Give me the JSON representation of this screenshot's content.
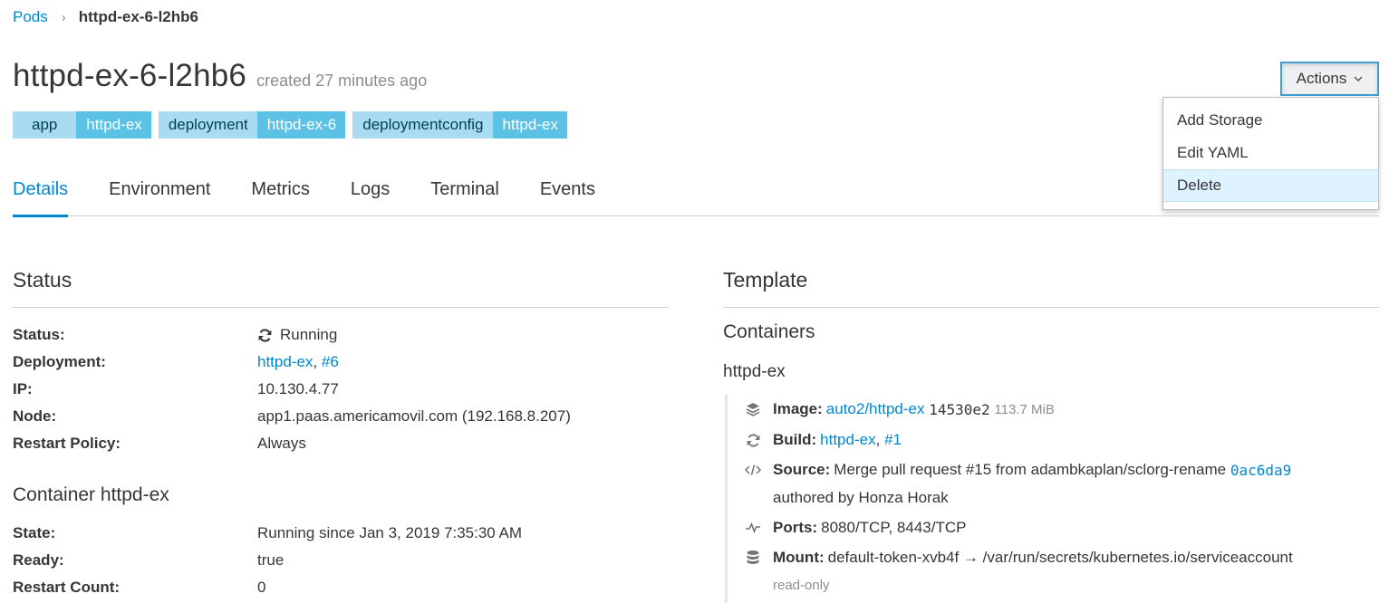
{
  "breadcrumb": {
    "parent": "Pods",
    "separator": "›",
    "current": "httpd-ex-6-l2hb6"
  },
  "header": {
    "title": "httpd-ex-6-l2hb6",
    "created": "created 27 minutes ago"
  },
  "labels": [
    {
      "key": "app",
      "value": "httpd-ex"
    },
    {
      "key": "deployment",
      "value": "httpd-ex-6"
    },
    {
      "key": "deploymentconfig",
      "value": "httpd-ex"
    }
  ],
  "actions": {
    "button_label": "Actions",
    "menu": [
      {
        "label": "Add Storage"
      },
      {
        "label": "Edit YAML"
      },
      {
        "label": "Delete"
      }
    ]
  },
  "tabs": [
    {
      "label": "Details"
    },
    {
      "label": "Environment"
    },
    {
      "label": "Metrics"
    },
    {
      "label": "Logs"
    },
    {
      "label": "Terminal"
    },
    {
      "label": "Events"
    }
  ],
  "status": {
    "heading": "Status",
    "status_label": "Status:",
    "status_value": "Running",
    "deployment_label": "Deployment:",
    "deployment_link": "httpd-ex",
    "deployment_sep": ",",
    "deployment_num": "#6",
    "ip_label": "IP:",
    "ip_value": "10.130.4.77",
    "node_label": "Node:",
    "node_value": "app1.paas.americamovil.com (192.168.8.207)",
    "restart_label": "Restart Policy:",
    "restart_value": "Always"
  },
  "container_status": {
    "heading": "Container httpd-ex",
    "state_label": "State:",
    "state_value": "Running since Jan 3, 2019 7:35:30 AM",
    "ready_label": "Ready:",
    "ready_value": "true",
    "restart_count_label": "Restart Count:",
    "restart_count_value": "0"
  },
  "template": {
    "heading": "Template",
    "containers_heading": "Containers",
    "container_name": "httpd-ex",
    "image_label": "Image:",
    "image_link": "auto2/httpd-ex",
    "image_hash": "14530e2",
    "image_size": "113.7 MiB",
    "build_label": "Build:",
    "build_link": "httpd-ex",
    "build_sep": ",",
    "build_num": "#1",
    "source_label": "Source:",
    "source_text": "Merge pull request #15 from adambkaplan/sclorg-rename",
    "source_commit": "0ac6da9",
    "source_author": "authored by Honza Horak",
    "ports_label": "Ports:",
    "ports_value": "8080/TCP, 8443/TCP",
    "mount_label": "Mount:",
    "mount_value": "default-token-xvb4f → /var/run/secrets/kubernetes.io/serviceaccount",
    "mount_mode": "read-only"
  },
  "icons": {
    "sync": "sync-icon",
    "image": "layers-icon",
    "build": "refresh-icon",
    "source": "code-icon",
    "ports": "pulse-icon",
    "mount": "database-icon",
    "chevron": "chevron-down-icon"
  },
  "colors": {
    "link": "#0088ce",
    "label_key_bg": "#a9dcf0",
    "label_value_bg": "#5bc2e5",
    "menu_active_bg": "#def3ff"
  }
}
